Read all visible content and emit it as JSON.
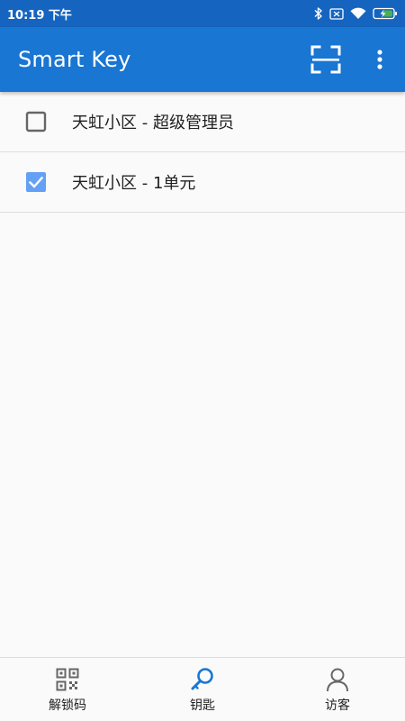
{
  "status_bar": {
    "time": "10:19 下午",
    "icons": [
      "bluetooth-icon",
      "sim-card-icon",
      "wifi-icon",
      "battery-charging-icon"
    ]
  },
  "app_bar": {
    "title": "Smart Key",
    "actions": [
      "scan-icon",
      "more-vert-icon"
    ]
  },
  "list": {
    "items": [
      {
        "label": "天虹小区 - 超级管理员",
        "checked": false
      },
      {
        "label": "天虹小区 - 1单元",
        "checked": true
      }
    ]
  },
  "bottom_nav": {
    "items": [
      {
        "label": "解锁码",
        "icon": "qr-code-icon",
        "active": false
      },
      {
        "label": "钥匙",
        "icon": "key-icon",
        "active": true
      },
      {
        "label": "访客",
        "icon": "person-icon",
        "active": false
      }
    ]
  },
  "colors": {
    "status_bar": "#1565c0",
    "app_bar": "#1976d2",
    "accent": "#1976d2",
    "checkbox_checked": "#64a0f5",
    "background": "#fafafa"
  }
}
